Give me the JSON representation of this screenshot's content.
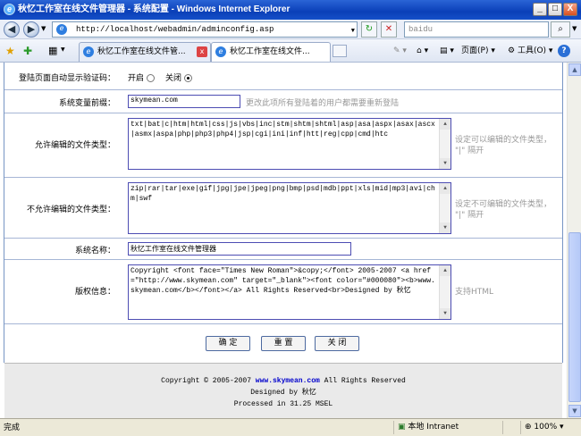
{
  "window": {
    "title": "秋忆工作室在线文件管理器 - 系统配置 - Windows Internet Explorer",
    "min": "_",
    "max": "□",
    "close": "X"
  },
  "toolbar": {
    "back": "◀",
    "forward": "▶",
    "url": "http://localhost/webadmin/adminconfig.asp",
    "refresh": "↻",
    "stop": "✕",
    "search_text": "baidu",
    "search_btn": "⌕"
  },
  "tabs": [
    {
      "label": "秋忆工作室在线文件管...",
      "close": "x"
    },
    {
      "label": "秋忆工作室在线文件..."
    }
  ],
  "command_bar": {
    "page": "页面(P)",
    "tools": "工具(O)",
    "help": "?"
  },
  "form": {
    "captcha": {
      "label": "登陆页面自动显示验证码：",
      "on": "开启",
      "off": "关闭",
      "selected": "off"
    },
    "prefix": {
      "label": "系统变量前缀：",
      "value": "skymean.com",
      "hint": "更改此项所有登陆着的用户都需要重新登陆"
    },
    "allowed": {
      "label": "允许编辑的文件类型：",
      "value": "txt|bat|c|htm|html|css|js|vbs|inc|stm|shtm|shtml|asp|asa|aspx|asax|ascx|asmx|aspa|php|php3|php4|jsp|cgi|ini|inf|htt|reg|cpp|cmd|htc",
      "hint1": "设定可以编辑的文件类型，",
      "hint2": "\"|\" 隔开"
    },
    "denied": {
      "label": "不允许编辑的文件类型：",
      "value": "zip|rar|tar|exe|gif|jpg|jpe|jpeg|png|bmp|psd|mdb|ppt|xls|mid|mp3|avi|chm|swf",
      "hint1": "设定不可编辑的文件类型，",
      "hint2": "\"|\" 隔开"
    },
    "sysname": {
      "label": "系统名称：",
      "value": "秋忆工作室在线文件管理器"
    },
    "copyright": {
      "label": "版权信息：",
      "value": "Copyright <font face=\"Times New Roman\">&copy;</font> 2005-2007 <a href=\"http://www.skymean.com\" target=\"_blank\"><font color=\"#000080\"><b>www.skymean.com</b></font></a> All Rights Reserved<br>Designed by 秋忆",
      "hint": "支持HTML"
    },
    "buttons": {
      "ok": "确 定",
      "reset": "重 置",
      "close": "关 闭"
    }
  },
  "footer": {
    "line1_pre": "Copyright © 2005-2007 ",
    "line1_link": "www.skymean.com",
    "line1_post": " All Rights Reserved",
    "line2": "Designed by 秋忆",
    "line3": "Processed in 31.25 MSEL"
  },
  "status": {
    "text": "完成",
    "zone": "本地 Intranet",
    "zoom": "100%"
  }
}
